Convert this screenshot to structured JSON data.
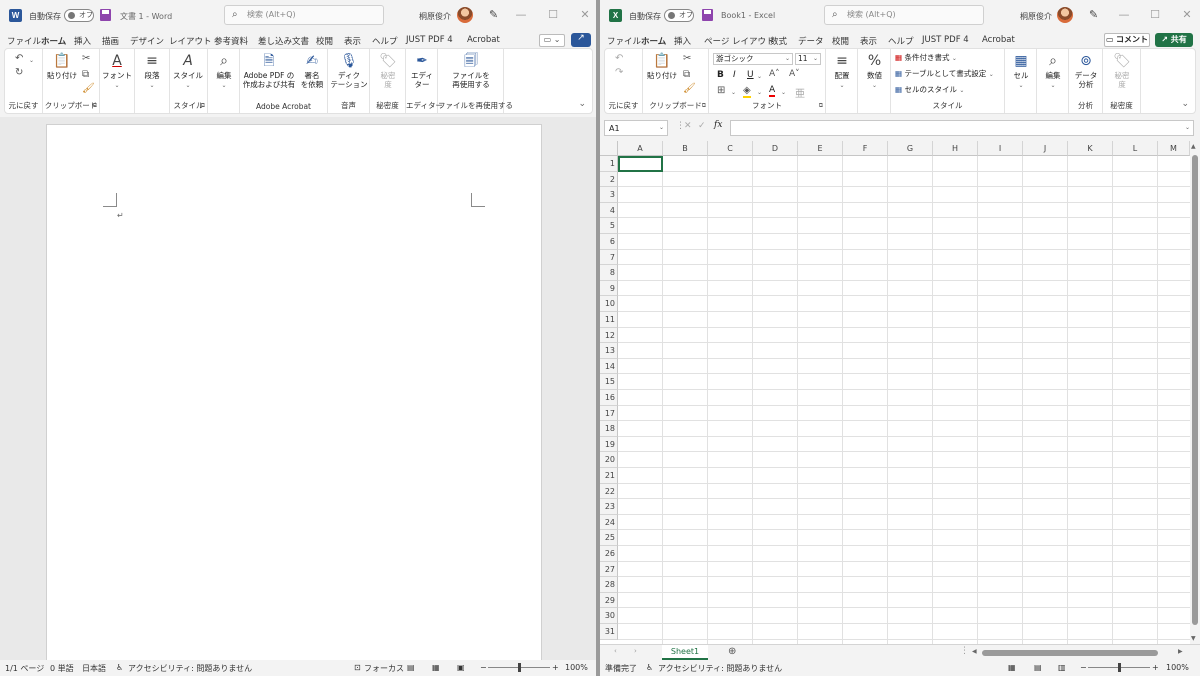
{
  "word": {
    "app_icon": "W",
    "autosave_label": "自動保存",
    "autosave_state": "オフ",
    "doc_title": "文書 1  -  Word",
    "search_placeholder": "検索 (Alt+Q)",
    "user_name": "桐原俊介",
    "tabs": [
      "ファイル",
      "ホーム",
      "挿入",
      "描画",
      "デザイン",
      "レイアウト",
      "参考資料",
      "差し込み文書",
      "校閲",
      "表示",
      "ヘルプ",
      "JUST PDF 4",
      "Acrobat"
    ],
    "ribbon": {
      "undo_group": "元に戻す",
      "paste": "貼り付け",
      "clipboard_group": "クリップボード",
      "font": "フォント",
      "paragraph": "段落",
      "style": "スタイル",
      "style_group": "スタイル",
      "edit": "編集",
      "acrobat_create_1": "Adobe PDF の",
      "acrobat_create_2": "作成および共有",
      "acrobat_sign_1": "署名",
      "acrobat_sign_2": "を依頼",
      "acrobat_group": "Adobe Acrobat",
      "dictate_1": "ディク",
      "dictate_2": "テーション",
      "voice_group": "音声",
      "sensitivity_1": "秘密",
      "sensitivity_2": "度",
      "sensitivity_group": "秘密度",
      "editor_1": "エディ",
      "editor_2": "ター",
      "editor_group": "エディター",
      "reuse_1": "ファイルを",
      "reuse_2": "再使用する",
      "reuse_group": "ファイルを再使用する"
    },
    "paragraph_mark": "↵",
    "status": {
      "page": "1/1 ページ",
      "words": "0 単語",
      "language": "日本語",
      "accessibility": "アクセシビリティ: 問題ありません",
      "focus": "フォーカス",
      "zoom": "100%"
    }
  },
  "excel": {
    "app_icon": "X",
    "autosave_label": "自動保存",
    "autosave_state": "オフ",
    "doc_title": "Book1  -  Excel",
    "search_placeholder": "検索 (Alt+Q)",
    "user_name": "桐原俊介",
    "tabs": [
      "ファイル",
      "ホーム",
      "挿入",
      "ページ レイアウト",
      "数式",
      "データ",
      "校閲",
      "表示",
      "ヘルプ",
      "JUST PDF 4",
      "Acrobat"
    ],
    "comment_btn": "コメント",
    "share_btn": "共有",
    "ribbon": {
      "undo_group": "元に戻す",
      "paste": "貼り付け",
      "clipboard_group": "クリップボード",
      "font_name": "游ゴシック",
      "font_size": "11",
      "font_group": "フォント",
      "align": "配置",
      "number": "数値",
      "cond_format": "条件付き書式",
      "table_format": "テーブルとして書式設定",
      "cell_style": "セルのスタイル",
      "style_group": "スタイル",
      "cells": "セル",
      "edit": "編集",
      "analyze_1": "データ",
      "analyze_2": "分析",
      "analysis_group": "分析",
      "sensitivity_1": "秘密",
      "sensitivity_2": "度",
      "sensitivity_group": "秘密度"
    },
    "namebox": "A1",
    "fx": "fx",
    "columns": [
      "A",
      "B",
      "C",
      "D",
      "E",
      "F",
      "G",
      "H",
      "I",
      "J",
      "K",
      "L",
      "M"
    ],
    "rows": [
      "1",
      "2",
      "3",
      "4",
      "5",
      "6",
      "7",
      "8",
      "9",
      "10",
      "11",
      "12",
      "13",
      "14",
      "15",
      "16",
      "17",
      "18",
      "19",
      "20",
      "21",
      "22",
      "23",
      "24",
      "25",
      "26",
      "27",
      "28",
      "29",
      "30",
      "31"
    ],
    "sheet_tab": "Sheet1",
    "status": {
      "ready": "準備完了",
      "accessibility": "アクセシビリティ: 問題ありません",
      "zoom": "100%"
    }
  }
}
